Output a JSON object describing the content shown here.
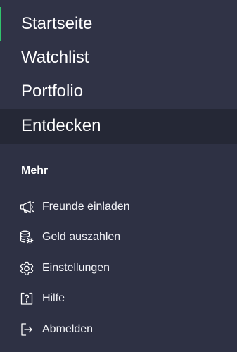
{
  "colors": {
    "background": "#2e3144",
    "top_menu_background": "#303346",
    "selected_item_background": "#252836",
    "active_indicator": "#31c46d",
    "text": "#ffffff"
  },
  "main_menu": {
    "active_item": "Startseite",
    "selected_item": "Entdecken",
    "items": [
      {
        "label": "Startseite"
      },
      {
        "label": "Watchlist"
      },
      {
        "label": "Portfolio"
      },
      {
        "label": "Entdecken"
      }
    ]
  },
  "more_section": {
    "title": "Mehr",
    "items": [
      {
        "label": "Freunde einladen",
        "icon": "megaphone-icon"
      },
      {
        "label": "Geld auszahlen",
        "icon": "coins-settings-icon"
      },
      {
        "label": "Einstellungen",
        "icon": "gear-icon"
      },
      {
        "label": "Hilfe",
        "icon": "help-question-icon"
      },
      {
        "label": "Abmelden",
        "icon": "logout-icon"
      }
    ]
  }
}
